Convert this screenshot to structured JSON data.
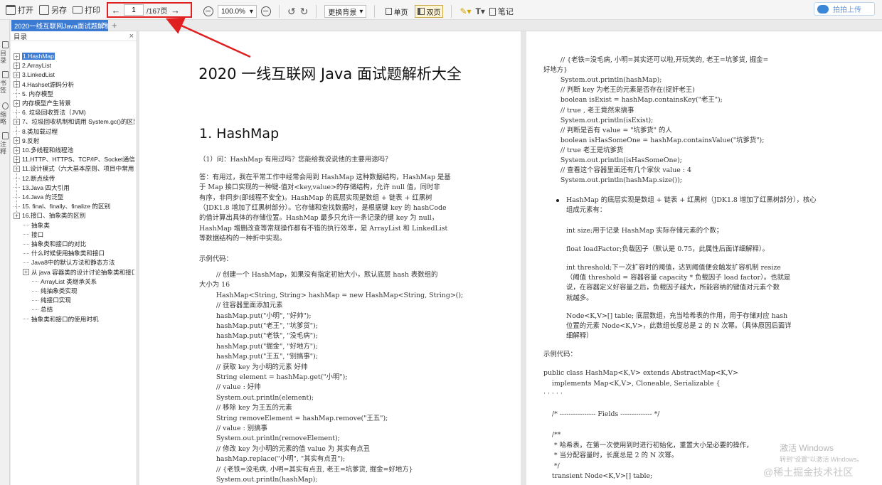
{
  "toolbar": {
    "open": "打开",
    "save_as": "另存",
    "print": "打印",
    "page_current": "1",
    "page_total": "/167页",
    "zoom": "100.0%",
    "background": "更换背景",
    "single_page": "单页",
    "double_page": "双页",
    "notes": "笔记",
    "upload": "拍拍上传"
  },
  "tab": {
    "title": "2020一线互联网Java面试题解析"
  },
  "rail": [
    "目录",
    "书签",
    "缩略",
    "注释"
  ],
  "outline": {
    "header": "目录",
    "items": [
      {
        "label": "1.HashMap",
        "selected": true
      },
      {
        "label": "2.ArrayList"
      },
      {
        "label": "3.LinkedList"
      },
      {
        "label": "4.Hashset源码分析"
      },
      {
        "label": "5. 内存模型"
      },
      {
        "label": "内存模型产生背景"
      },
      {
        "label": "6. 垃圾回收算法（JVM)"
      },
      {
        "label": "7、垃圾回收机制和调用 System.gc()的区别"
      },
      {
        "label": "8.类加载过程"
      },
      {
        "label": "9.反射"
      },
      {
        "label": "10.多线程和线程池"
      },
      {
        "label": "11.HTTP、HTTPS、TCP/IP、Socket通信、三次握手"
      },
      {
        "label": "11.设计模式（六大基本原则、项目中常用的设计模式"
      },
      {
        "label": "12.断点续传"
      },
      {
        "label": "13.Java 四大引用"
      },
      {
        "label": "14.Java 的泛型"
      },
      {
        "label": "15. final、finally、finalize 的区别"
      },
      {
        "label": "16.接口、抽象类的区别"
      },
      {
        "label": "抽象类"
      },
      {
        "label": "接口"
      },
      {
        "label": "抽象类和接口的对比"
      },
      {
        "label": "什么时候使用抽象类和接口"
      },
      {
        "label": "Java8中的默认方法和静态方法"
      },
      {
        "label": "从 java 容器类的设计讨论抽象类和接口的应用"
      },
      {
        "label": "ArrayList 类继承关系"
      },
      {
        "label": "纯抽象类实现"
      },
      {
        "label": "纯接口实现"
      },
      {
        "label": "总结"
      },
      {
        "label": "抽象类和接口的使用时机"
      }
    ]
  },
  "page1": {
    "title": "2020 一线互联网 Java 面试题解析大全",
    "heading": "1.  HashMap",
    "q1": "（1）问：HashMap 有用过吗？您能给我说说他的主要用途吗？",
    "answer": [
      "答：有用过，我在平常工作中经常会用到 HashMap 这种数据结构，HashMap 是基",
      "于 Map 接口实现的一种键-值对<key,value>的存储结构，允许 null 值，同时非",
      "有序，非同步(即线程不安全)。HashMap 的底层实现是数组 + 链表 + 红黑树",
      "（JDK1.8 增加了红黑树部分）。它存储和查找数据时，是根据键 key 的 hashCode",
      "的值计算出具体的存储位置。HashMap 最多只允许一条记录的键 key 为 null，",
      "HashMap 增删改查等常规操作都有不错的执行效率，是 ArrayList 和 LinkedList",
      "等数据结构的一种折中实现。"
    ],
    "example_label": "示例代码：",
    "code": [
      "        // 创建一个 HashMap，如果没有指定初始大小，默认底层 hash 表数组的",
      "大小为 16",
      "        HashMap<String, String> hashMap = new HashMap<String, String>();",
      "        // 往容器里面添加元素",
      "        hashMap.put(\"小明\", \"好帅\");",
      "        hashMap.put(\"老王\", \"坑爹货\");",
      "        hashMap.put(\"老铁\", \"没毛病\");",
      "        hashMap.put(\"掘金\", \"好地方\");",
      "        hashMap.put(\"王五\", \"别搞事\");",
      "        // 获取 key 为小明的元素 好帅",
      "        String element = hashMap.get(\"小明\");",
      "        // value : 好帅",
      "        System.out.println(element);",
      "        // 移除 key 为王五的元素",
      "        String removeElement = hashMap.remove(\"王五\");",
      "        // value : 别搞事",
      "        System.out.println(removeElement);",
      "        // 修改 key 为小明的元素的值 value 为 其实有点丑",
      "        hashMap.replace(\"小明\", \"其实有点丑\");",
      "        // {老铁=没毛病, 小明=其实有点丑, 老王=坑爹货, 掘金=好地方}",
      "        System.out.println(hashMap);",
      "        // 通过 ... 方法也可以达到修改元素的值的效果"
    ]
  },
  "page2": {
    "code_top": [
      "        // {老铁=没毛病, 小明=其实还可以啦,开玩笑的, 老王=坑爹货, 掘金=",
      "好地方}",
      "        System.out.println(hashMap);",
      "        // 判断 key 为老王的元素是否存在(捉奸老王)",
      "        boolean isExist = hashMap.containsKey(\"老王\");",
      "        // true , 老王竟然来搞事",
      "        System.out.println(isExist);",
      "        // 判断是否有 value = \"坑爹货\" 的人",
      "        boolean isHasSomeOne = hashMap.containsValue(\"坑爹货\");",
      "        // true 老王是坑爹货",
      "        System.out.println(isHasSomeOne);",
      "        // 查看这个容器里面还有几个家伙 value : 4",
      "        System.out.println(hashMap.size());"
    ],
    "bullet": [
      "HashMap 的底层实现是数组 + 链表 + 红黑树（JDK1.8 增加了红黑树部分），核心",
      "组成元素有："
    ],
    "size_line": "int size;用于记录 HashMap 实际存储元素的个数；",
    "load_line": "float loadFactor;负载因子（默认是 0.75，此属性后面详细解释）。",
    "threshold": [
      "int threshold;下一次扩容时的阈值，达到阈值便会触发扩容机制 resize",
      "（阈值  threshold = 容器容量 capacity * 负载因子 load factor）。也就是",
      "说，在容器定义好容量之后，负载因子越大，所能容纳的键值对元素个数",
      "就越多。"
    ],
    "table": [
      "Node<K,V>[] table; 底层数组，充当哈希表的作用，用于存储对应 hash",
      "位置的元素 Node<K,V>，此数组长度总是 2 的 N 次幂。（具体原因后面详",
      "细解释）"
    ],
    "example_label": "示例代码：",
    "code_bottom": [
      "public class HashMap<K,V> extends AbstractMap<K,V>",
      "    implements Map<K,V>, Cloneable, Serializable {",
      "· · · · ·",
      "",
      "    /* ---------------- Fields -------------- */",
      "",
      "    /**",
      "     * 哈希表，在第一次使用到时进行初始化，重置大小是必要的操作，",
      "     * 当分配容量时，长度总是 2 的 N 次幂。",
      "     */",
      "    transient Node<K,V>[] table;"
    ]
  },
  "watermark": {
    "line1": "激活 Windows",
    "line2": "转到\"设置\"以激活 Windows。",
    "brand": "@稀土掘金技术社区"
  },
  "colors": {
    "accent": "#3b7bd4",
    "highlight_border": "#e02020"
  }
}
